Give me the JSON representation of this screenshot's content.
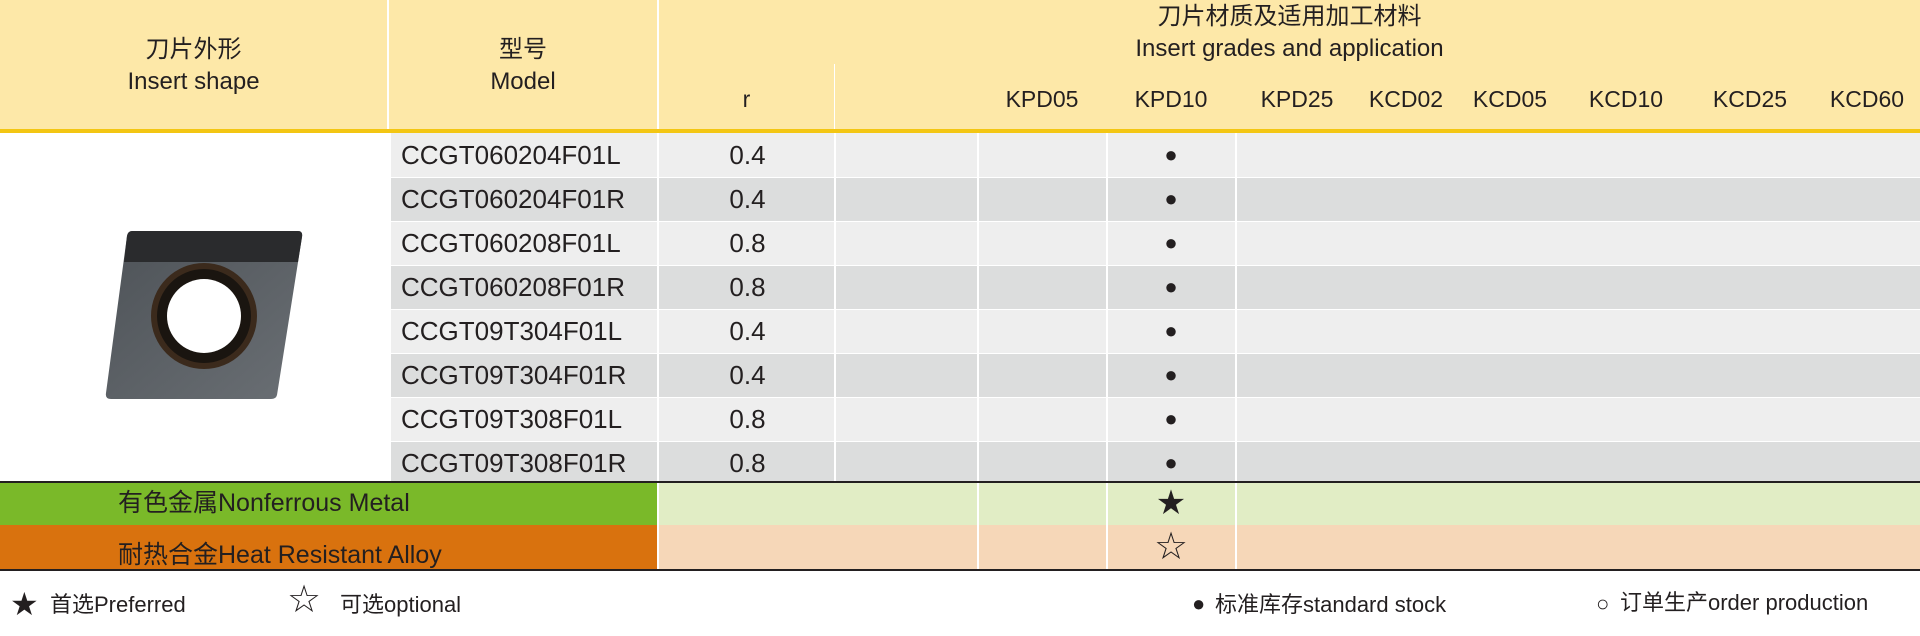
{
  "header": {
    "shape_zh": "刀片外形",
    "shape_en": "Insert shape",
    "model_zh": "型号",
    "model_en": "Model",
    "grades_zh": "刀片材质及适用加工材料",
    "grades_en": "Insert grades and application",
    "columns": [
      "r",
      "KPD05",
      "KPD10",
      "KPD25",
      "KCD02",
      "KCD05",
      "KCD10",
      "KCD25",
      "KCD60"
    ]
  },
  "rows": [
    {
      "model": "CCGT060204F01L",
      "r": "0.4",
      "mark": "●"
    },
    {
      "model": "CCGT060204F01R",
      "r": "0.4",
      "mark": "●"
    },
    {
      "model": "CCGT060208F01L",
      "r": "0.8",
      "mark": "●"
    },
    {
      "model": "CCGT060208F01R",
      "r": "0.8",
      "mark": "●"
    },
    {
      "model": "CCGT09T304F01L",
      "r": "0.4",
      "mark": "●"
    },
    {
      "model": "CCGT09T304F01R",
      "r": "0.4",
      "mark": "●"
    },
    {
      "model": "CCGT09T308F01L",
      "r": "0.8",
      "mark": "●"
    },
    {
      "model": "CCGT09T308F01R",
      "r": "0.8",
      "mark": "●"
    }
  ],
  "applications": [
    {
      "label": "有色金属Nonferrous Metal",
      "symbol": "★",
      "band_color": "#7ab929",
      "cell_color": "#e1edc5"
    },
    {
      "label": "耐热合金Heat Resistant Alloy",
      "symbol": "☆",
      "band_color": "#d9720e",
      "cell_color": "#f6d7b8"
    }
  ],
  "legend": {
    "preferred_symbol": "★",
    "preferred_label": "首选Preferred",
    "optional_symbol": "☆",
    "optional_label": "可选optional",
    "stock_symbol": "●",
    "stock_label": "标准库存standard stock",
    "order_symbol": "○",
    "order_label": "订单生产order production"
  },
  "colors": {
    "header_bg": "#fde8a8",
    "header_line": "#f3c613"
  }
}
